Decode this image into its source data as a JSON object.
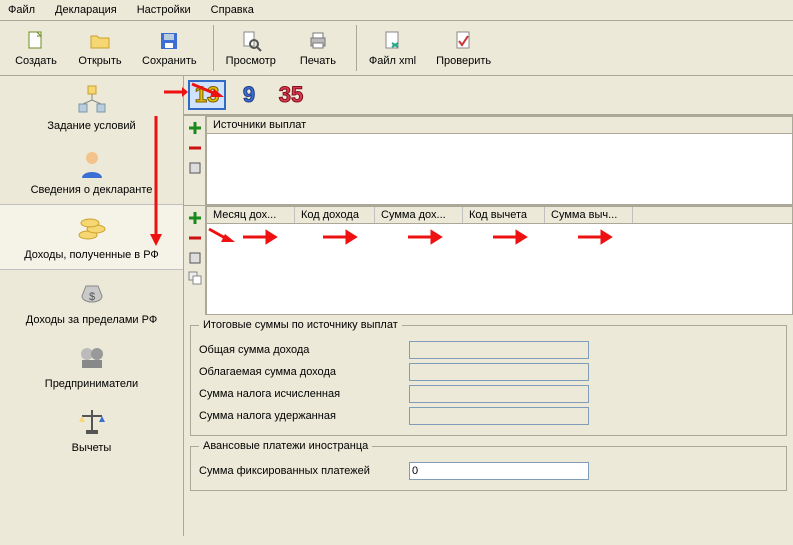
{
  "menu": {
    "file": "Файл",
    "declaration": "Декларация",
    "settings": "Настройки",
    "help": "Справка"
  },
  "toolbar": {
    "create": "Создать",
    "open": "Открыть",
    "save": "Сохранить",
    "preview": "Просмотр",
    "print": "Печать",
    "xml": "Файл xml",
    "check": "Проверить"
  },
  "sidebar": {
    "conditions": "Задание условий",
    "declarant": "Сведения о декларанте",
    "income_rf": "Доходы, полученные в РФ",
    "income_abroad": "Доходы за пределами РФ",
    "entrepreneur": "Предприниматели",
    "deductions": "Вычеты"
  },
  "rates": {
    "r13": "13",
    "r9": "9",
    "r35": "35"
  },
  "sources": {
    "title": "Источники выплат"
  },
  "grid": {
    "month": "Месяц дох...",
    "code_income": "Код дохода",
    "sum_income": "Сумма дох...",
    "code_deduct": "Код вычета",
    "sum_deduct": "Сумма выч..."
  },
  "totals": {
    "legend": "Итоговые суммы по источнику выплат",
    "total_income": "Общая сумма дохода",
    "taxable_income": "Облагаемая сумма дохода",
    "tax_calculated": "Сумма налога исчисленная",
    "tax_withheld": "Сумма налога удержанная"
  },
  "advance": {
    "legend": "Авансовые платежи иностранца",
    "fixed": "Сумма фиксированных платежей",
    "value": "0"
  }
}
